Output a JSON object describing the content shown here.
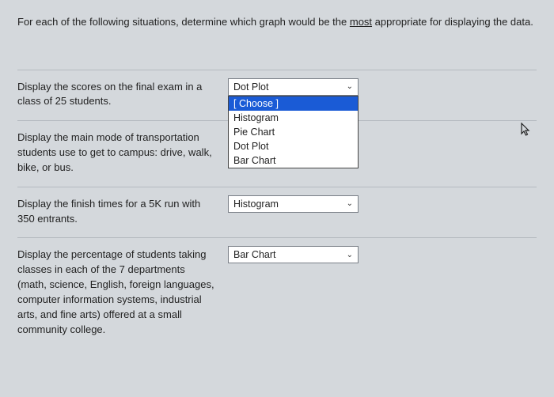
{
  "instructions": {
    "pre": "For each of the following situations, determine which graph would be the ",
    "underlined": "most",
    "post": " appropriate for displaying the data."
  },
  "questions": [
    {
      "prompt": "Display the scores on the final exam in a class of 25 students.",
      "selected": "Dot Plot",
      "expanded": true
    },
    {
      "prompt": "Display the main mode of transportation students use to get to campus:  drive, walk, bike, or bus.",
      "selected": "",
      "expanded": false,
      "hidden_select": true
    },
    {
      "prompt": "Display the finish times for a 5K run with 350 entrants.",
      "selected": "Histogram",
      "expanded": false
    },
    {
      "prompt": "Display the percentage of students taking classes in each of the 7 departments (math, science, English, foreign languages, computer information systems, industrial arts, and fine arts) offered at a small community college.",
      "selected": "Bar Chart",
      "expanded": false
    }
  ],
  "dropdown_options": [
    {
      "label": "[ Choose ]",
      "highlight": true
    },
    {
      "label": "Histogram",
      "highlight": false
    },
    {
      "label": "Pie Chart",
      "highlight": false
    },
    {
      "label": "Dot Plot",
      "highlight": false
    },
    {
      "label": "Bar Chart",
      "highlight": false
    }
  ]
}
